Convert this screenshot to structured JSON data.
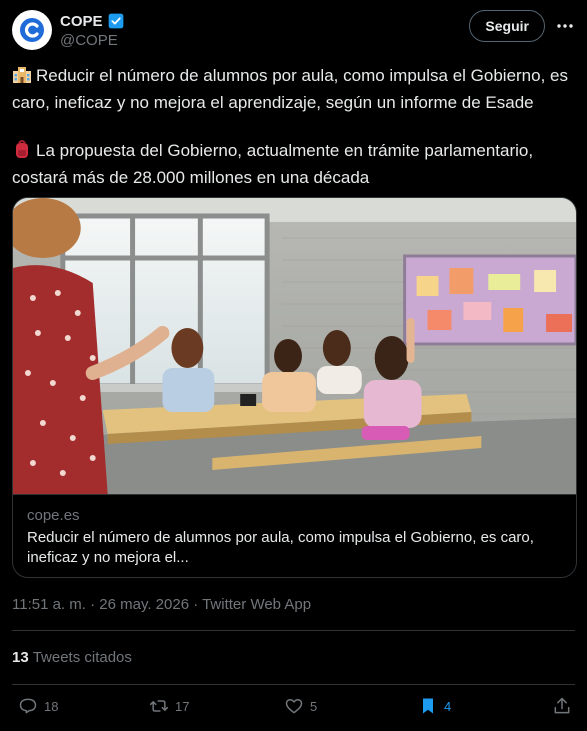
{
  "account": {
    "display_name": "COPE",
    "handle": "@COPE",
    "follow_label": "Seguir",
    "verified_color": "#1d9bf0"
  },
  "tweet": {
    "paragraph_1": "Reducir el número de alumnos por aula, como impulsa el Gobierno, es caro, ineficaz y no mejora el aprendizaje, según un informe de Esade",
    "paragraph_2": "La propuesta del Gobierno, actualmente en trámite parlamentario, costará más de 28.000 millones en una década",
    "emoji_1": "school-building-emoji",
    "emoji_2": "backpack-emoji"
  },
  "card": {
    "domain": "cope.es",
    "title": "Reducir el número de alumnos por aula, como impulsa el Gobierno, es caro, ineficaz y no mejora el..."
  },
  "meta": {
    "timestamp": "11:51 a. m. · 26 may. 2026 · Twitter Web App",
    "quote_count": "13",
    "quote_label": "Tweets citados"
  },
  "actions": {
    "replies": "18",
    "retweets": "17",
    "likes": "5",
    "bookmarks": "4",
    "bookmark_color": "#1d9bf0"
  }
}
